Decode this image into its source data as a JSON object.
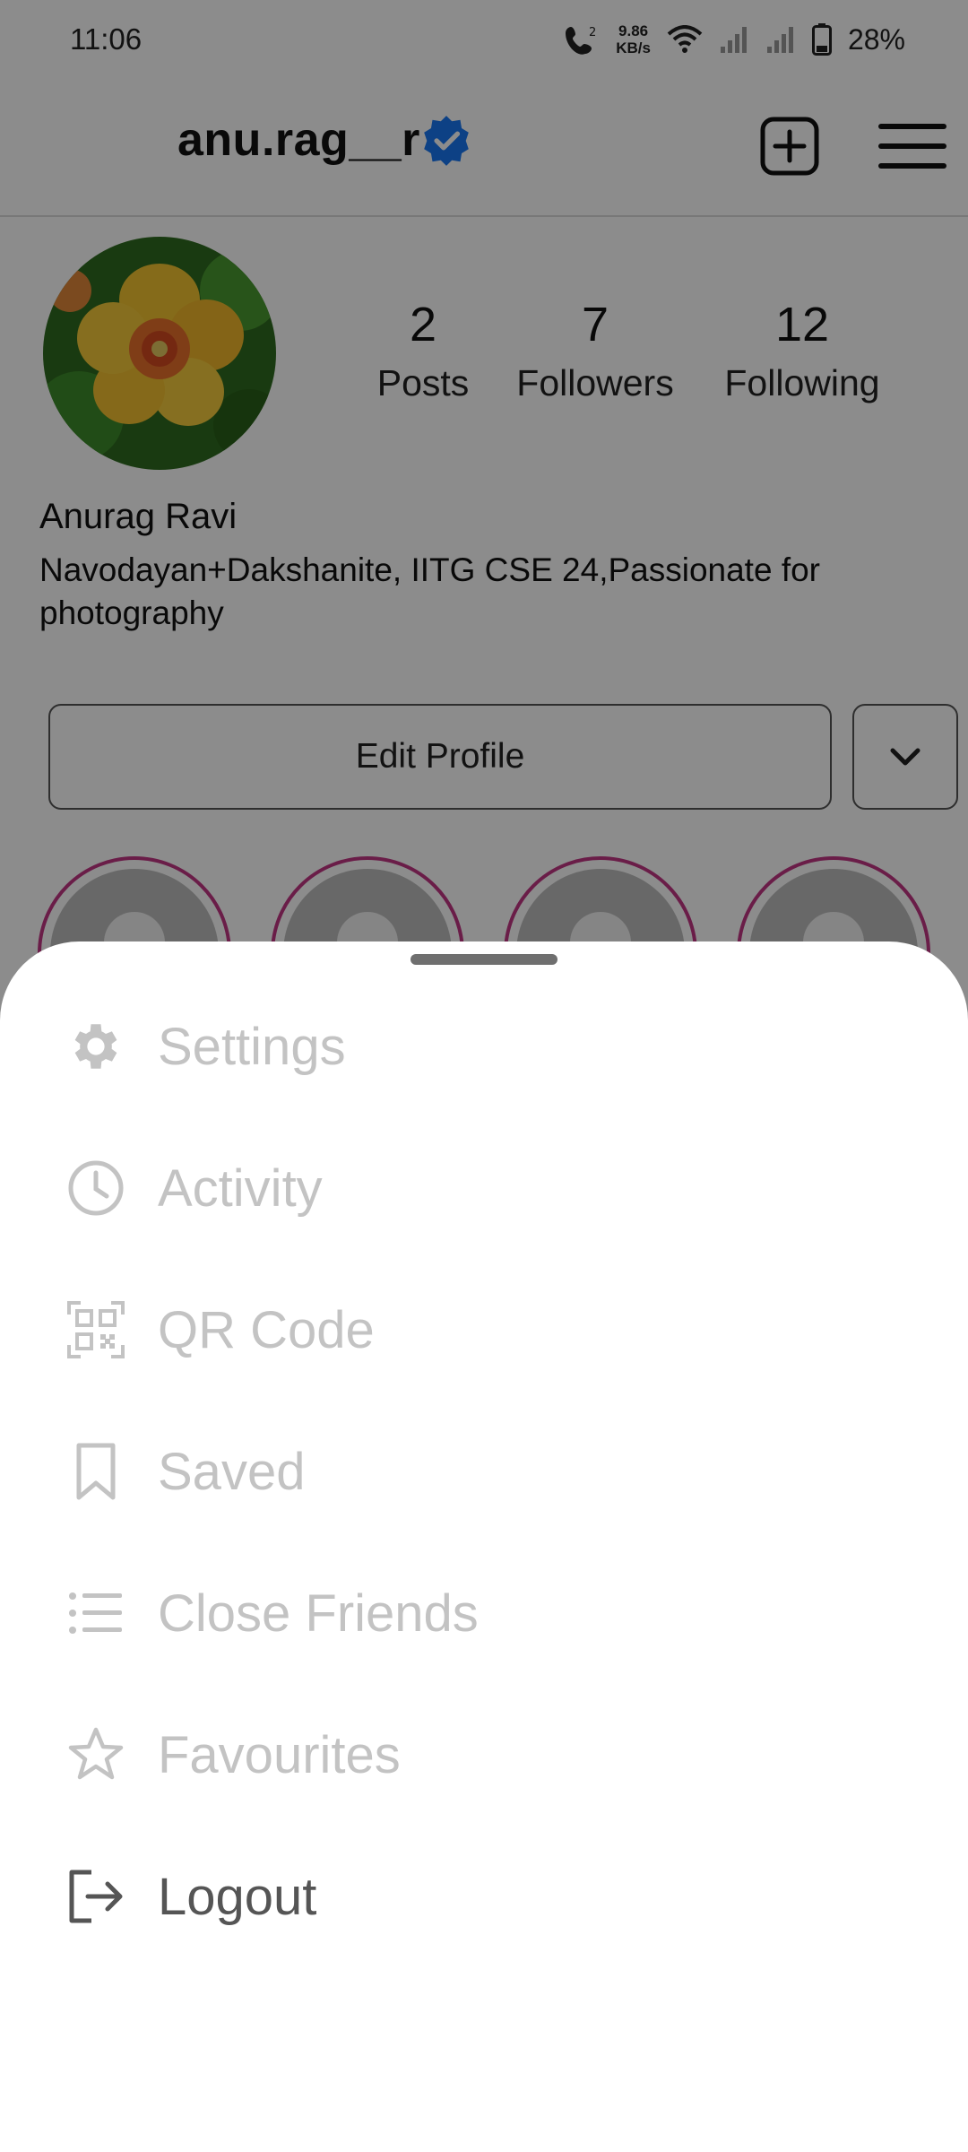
{
  "status_bar": {
    "time": "11:06",
    "speed_value": "9.86",
    "speed_unit": "KB/s",
    "battery": "28%"
  },
  "header": {
    "username": "anu.rag__r",
    "verified_icon": "verified-badge-icon",
    "new_post_icon": "plus-square-icon",
    "menu_icon": "hamburger-menu-icon"
  },
  "profile": {
    "stats": [
      {
        "value": "2",
        "label": "Posts"
      },
      {
        "value": "7",
        "label": "Followers"
      },
      {
        "value": "12",
        "label": "Following"
      }
    ],
    "full_name": "Anurag Ravi",
    "bio": "Navodayan+Dakshanite, IITG CSE 24,Passionate for photography",
    "edit_profile_label": "Edit Profile",
    "dropdown_icon": "chevron-down-icon"
  },
  "highlights_count": 4,
  "menu": {
    "items": [
      {
        "label": "Settings",
        "icon": "gear-icon",
        "enabled": false
      },
      {
        "label": "Activity",
        "icon": "clock-icon",
        "enabled": false
      },
      {
        "label": "QR Code",
        "icon": "qr-code-icon",
        "enabled": false
      },
      {
        "label": "Saved",
        "icon": "bookmark-icon",
        "enabled": false
      },
      {
        "label": "Close Friends",
        "icon": "list-icon",
        "enabled": false
      },
      {
        "label": "Favourites",
        "icon": "star-icon",
        "enabled": false
      },
      {
        "label": "Logout",
        "icon": "logout-icon",
        "enabled": true
      }
    ]
  },
  "colors": {
    "verified": "#1877F2",
    "story_ring": "#C13584",
    "menu_disabled_text": "#C3C3C3",
    "menu_active_text": "#555555"
  }
}
